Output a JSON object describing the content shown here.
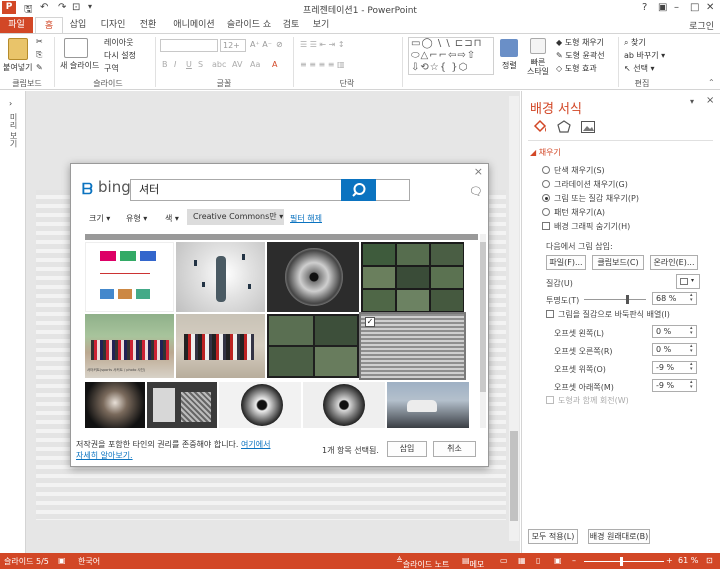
{
  "window": {
    "title": "프레젠테이션1 - PowerPoint",
    "login": "로그인",
    "app_logo": "P"
  },
  "tabs": [
    "파일",
    "홈",
    "삽입",
    "디자인",
    "전환",
    "애니메이션",
    "슬라이드 쇼",
    "검토",
    "보기"
  ],
  "ribbon": {
    "clipboard": {
      "label": "클립보드",
      "paste": "붙여넣기"
    },
    "slides": {
      "label": "슬라이드",
      "new_slide": "새 슬라이드",
      "layout": "레이아웃",
      "reset": "다시 설정",
      "section": "구역"
    },
    "font": {
      "label": "글꼴",
      "size": "12+"
    },
    "paragraph": {
      "label": "단락"
    },
    "drawing": {
      "arrange": "정렬",
      "quick_styles": "빠른 스타일",
      "shape_fill": "도형 채우기",
      "shape_outline": "도형 윤곽선",
      "shape_effects": "도형 효과"
    },
    "editing": {
      "label": "편집",
      "find": "찾기",
      "replace": "바꾸기",
      "select": "선택"
    }
  },
  "dialog": {
    "brand": "bing",
    "search_value": "셔터",
    "filters": {
      "size": "크기",
      "type": "유형",
      "color": "색",
      "license": "Creative Commons만",
      "clear": "필터 해제"
    },
    "thumbnail_caption": "서터커트(sports 서커트 / photo 사진)",
    "footer_text": "저작권을 포함한 타인의 권리를 존중해야 합니다. ",
    "footer_link_1": "여기에서",
    "footer_link_2": "자세히 알아보기.",
    "selection_count": "1개 항목 선택됨.",
    "insert_button": "삽입",
    "cancel_button": "취소",
    "close": "×"
  },
  "pane": {
    "title": "배경 서식",
    "section": "채우기",
    "options": [
      "단색 채우기(S)",
      "그라데이션 채우기(G)",
      "그림 또는 질감 채우기(P)",
      "패턴 채우기(A)"
    ],
    "hide_bg": "배경 그래픽 숨기기(H)",
    "insert_from": "다음에서 그림 삽입:",
    "file_btn": "파일(F)...",
    "clipboard_btn": "클립보드(C)",
    "online_btn": "온라인(E)...",
    "texture": "질감(U)",
    "transparency": "투명도(T)",
    "transparency_value": "68 %",
    "tile_check": "그림을 질감으로 바둑판식 배열(I)",
    "offsets": [
      {
        "label": "오프셋 왼쪽(L)",
        "value": "0 %"
      },
      {
        "label": "오프셋 오른쪽(R)",
        "value": "0 %"
      },
      {
        "label": "오프셋 위쪽(O)",
        "value": "-9 %"
      },
      {
        "label": "오프셋 아래쪽(M)",
        "value": "-9 %"
      }
    ],
    "rotate_with_shape": "도형과 함께 회전(W)",
    "apply_all": "모두 적용(L)",
    "reset_bg": "배경 원래대로(B)"
  },
  "statusbar": {
    "slide": "슬라이드 5/5",
    "language": "한국어",
    "notes": "슬라이드 노트",
    "comments": "메모",
    "zoom": "61 %"
  },
  "left_rail": {
    "thumbnails_label": "미리 보기"
  },
  "colors": {
    "accent": "#d24726",
    "bing_blue": "#0b73c0"
  }
}
